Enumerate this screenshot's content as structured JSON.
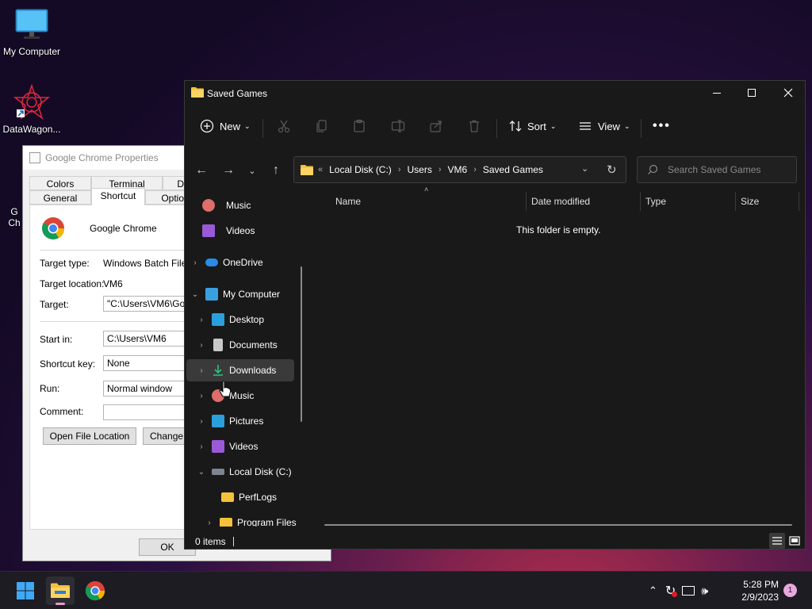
{
  "desktop": {
    "icons": [
      {
        "label": "My Computer",
        "icon": "monitor-icon"
      },
      {
        "label": "DataWagon...",
        "icon": "datawagon-icon"
      },
      {
        "label": "G\nCh",
        "icon": "chrome-shortcut-icon"
      }
    ]
  },
  "properties": {
    "title": "Google Chrome Properties",
    "tabs_top": [
      "Colors",
      "Terminal",
      "D"
    ],
    "tabs_bottom": [
      "General",
      "Shortcut",
      "Optio"
    ],
    "active_tab": "Shortcut",
    "app_name": "Google Chrome",
    "target_type_label": "Target type:",
    "target_type_value": "Windows Batch File",
    "target_location_label": "Target location:",
    "target_location_value": "VM6",
    "target_label": "Target:",
    "target_value": "\"C:\\Users\\VM6\\Goo",
    "start_in_label": "Start in:",
    "start_in_value": "C:\\Users\\VM6",
    "shortcut_key_label": "Shortcut key:",
    "shortcut_key_value": "None",
    "run_label": "Run:",
    "run_value": "Normal window",
    "comment_label": "Comment:",
    "comment_value": "",
    "open_location_btn": "Open File Location",
    "change_btn": "Change",
    "ok_btn": "OK"
  },
  "explorer": {
    "title": "Saved Games",
    "toolbar": {
      "new_label": "New",
      "sort_label": "Sort",
      "view_label": "View"
    },
    "address": {
      "prefix": "«",
      "crumbs": [
        "Local Disk (C:)",
        "Users",
        "VM6",
        "Saved Games"
      ]
    },
    "search_placeholder": "Search Saved Games",
    "nav": [
      {
        "label": "Music",
        "icon": "music-icon",
        "expander": false
      },
      {
        "label": "Videos",
        "icon": "videos-icon",
        "expander": false
      },
      {
        "label": "OneDrive",
        "icon": "onedrive-icon",
        "expander": "collapsed"
      },
      {
        "label": "My Computer",
        "icon": "monitor-icon",
        "expander": "expanded"
      },
      {
        "label": "Desktop",
        "icon": "desktop-icon",
        "expander": "collapsed"
      },
      {
        "label": "Documents",
        "icon": "documents-icon",
        "expander": "collapsed"
      },
      {
        "label": "Downloads",
        "icon": "downloads-icon",
        "expander": "collapsed"
      },
      {
        "label": "Music",
        "icon": "music-icon",
        "expander": "collapsed"
      },
      {
        "label": "Pictures",
        "icon": "pictures-icon",
        "expander": "collapsed"
      },
      {
        "label": "Videos",
        "icon": "videos-icon",
        "expander": "collapsed"
      },
      {
        "label": "Local Disk (C:)",
        "icon": "drive-icon",
        "expander": "expanded"
      },
      {
        "label": "PerfLogs",
        "icon": "folder-icon",
        "expander": false
      },
      {
        "label": "Program Files",
        "icon": "folder-icon",
        "expander": "collapsed"
      }
    ],
    "selected_nav": "Downloads",
    "columns": [
      "Name",
      "Date modified",
      "Type",
      "Size"
    ],
    "empty_message": "This folder is empty.",
    "status": "0 items"
  },
  "taskbar": {
    "time": "5:28 PM",
    "date": "2/9/2023",
    "notification_count": "1"
  },
  "colors": {
    "explorer_bg": "#191919",
    "accent": "#0078d4",
    "folder": "#f3c13a"
  }
}
